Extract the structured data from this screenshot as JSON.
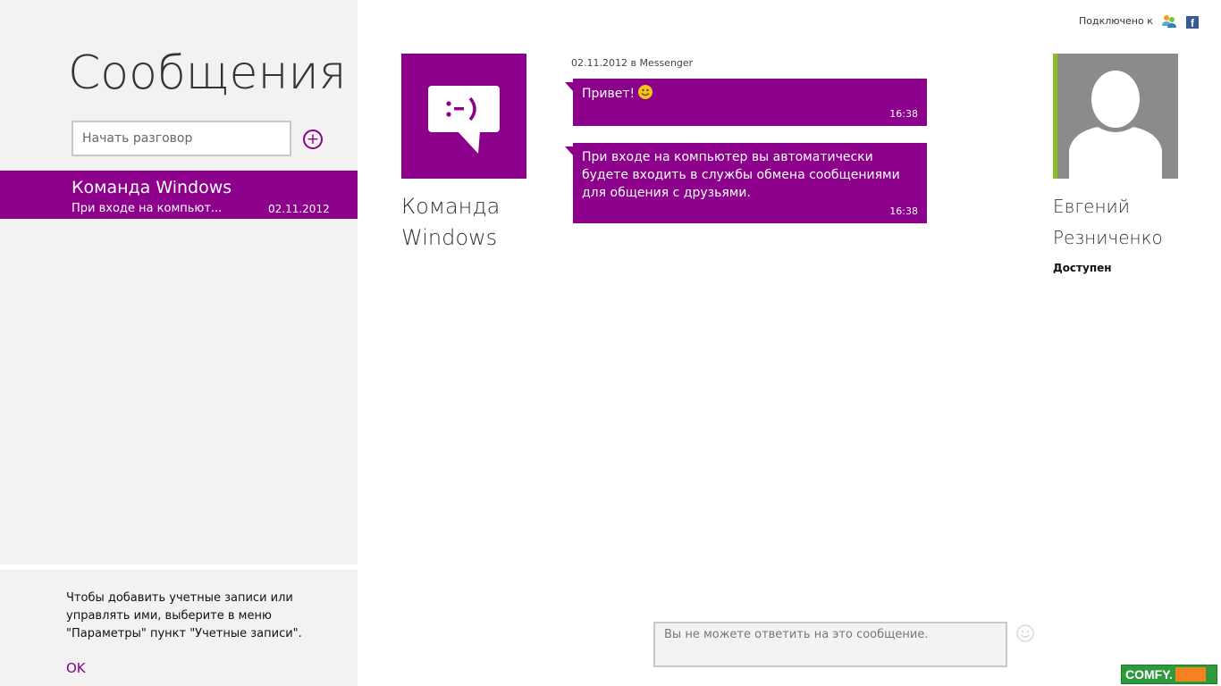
{
  "sidebar": {
    "title": "Сообщения",
    "search_placeholder": "Начать разговор",
    "add_label": "+",
    "conversations": [
      {
        "name": "Команда Windows",
        "preview": "При входе на компьют...",
        "date": "02.11.2012"
      }
    ],
    "footer": {
      "text": "Чтобы добавить учетные записи или управлять ими, выберите в меню \"Параметры\" пункт \"Учетные записи\".",
      "ok_label": "OK"
    }
  },
  "header": {
    "connected_label": "Подключено к",
    "services": [
      "messenger-icon",
      "facebook-icon"
    ]
  },
  "conversation": {
    "contact_name": "Команда Windows",
    "date_line": "02.11.2012 в Messenger",
    "messages": [
      {
        "text": "Привет!",
        "time": "16:38",
        "emoticon": "smiley-icon"
      },
      {
        "text": "При входе на компьютер вы автоматически будете входить в службы обмена сообщениями для общения с друзьями.",
        "time": "16:38"
      }
    ],
    "reply_placeholder": "Вы не можете ответить на это сообщение."
  },
  "profile": {
    "name": "Евгений Резниченко",
    "status": "Доступен"
  },
  "watermark": {
    "brand": "COMFY."
  },
  "colors": {
    "accent": "#8c008c",
    "presence": "#8cbf26",
    "facebook": "#3b5998",
    "comfy_green": "#2e9a3e",
    "comfy_orange": "#f58220"
  }
}
